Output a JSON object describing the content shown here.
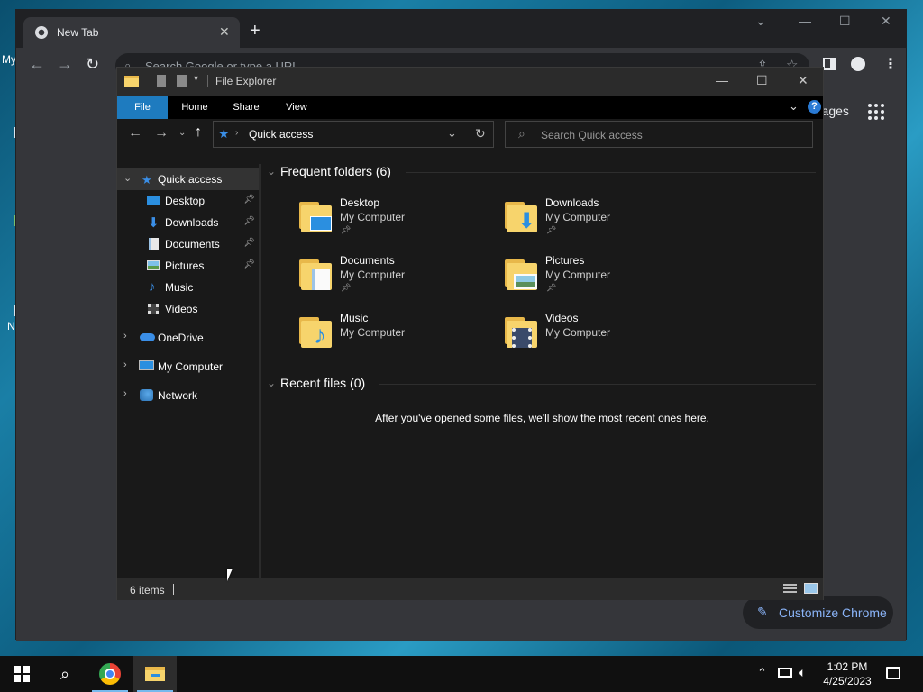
{
  "chrome": {
    "tab_title": "New Tab",
    "omnibox_placeholder": "Search Google or type a URL",
    "images_link": "Images",
    "customize_label": "Customize Chrome",
    "desktop_label_1": "My",
    "desktop_label_2": "N"
  },
  "explorer": {
    "title": "File Explorer",
    "ribbon_tabs": [
      "File",
      "Home",
      "Share",
      "View"
    ],
    "address_path": "Quick access",
    "search_placeholder": "Search Quick access",
    "nav": {
      "quick_access": "Quick access",
      "desktop": "Desktop",
      "downloads": "Downloads",
      "documents": "Documents",
      "pictures": "Pictures",
      "music": "Music",
      "videos": "Videos",
      "onedrive": "OneDrive",
      "my_computer": "My Computer",
      "network": "Network"
    },
    "frequent_title": "Frequent folders (6)",
    "folders": [
      {
        "name": "Desktop",
        "location": "My Computer",
        "pinned": true,
        "icon": "desktop-folder-icon"
      },
      {
        "name": "Downloads",
        "location": "My Computer",
        "pinned": true,
        "icon": "downloads-folder-icon"
      },
      {
        "name": "Documents",
        "location": "My Computer",
        "pinned": true,
        "icon": "documents-folder-icon"
      },
      {
        "name": "Pictures",
        "location": "My Computer",
        "pinned": true,
        "icon": "pictures-folder-icon"
      },
      {
        "name": "Music",
        "location": "My Computer",
        "pinned": false,
        "icon": "music-folder-icon"
      },
      {
        "name": "Videos",
        "location": "My Computer",
        "pinned": false,
        "icon": "videos-folder-icon"
      }
    ],
    "recent_title": "Recent files (0)",
    "recent_empty": "After you've opened some files, we'll show the most recent ones here.",
    "status_items": "6 items"
  },
  "taskbar": {
    "time": "1:02 PM",
    "date": "4/25/2023"
  },
  "colors": {
    "ribbon_file": "#1e7bbf",
    "chrome_accent": "#8ab4f8",
    "folder_yellow": "#f7d46c"
  }
}
